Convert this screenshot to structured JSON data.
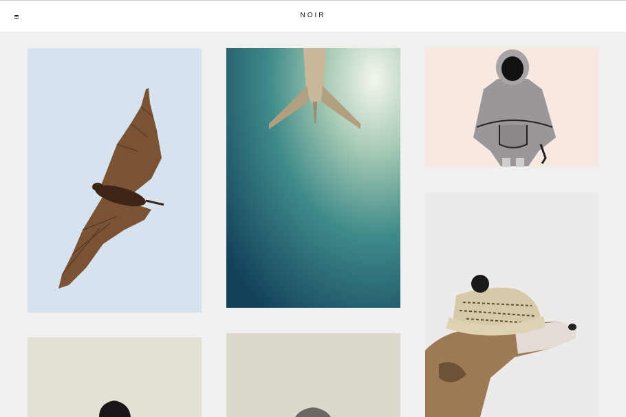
{
  "header": {
    "logo": "NOIR",
    "menu_icon": "hamburger-menu-icon"
  },
  "gallery": {
    "items": [
      {
        "subject": "bat",
        "background": "#d6e3ee"
      },
      {
        "subject": "airplane",
        "background": "#2e7275"
      },
      {
        "subject": "hooded-figure",
        "background": "#f7e8e2"
      },
      {
        "subject": "dog-with-knit-hat",
        "background": "#ecebea"
      },
      {
        "subject": "woman-portrait",
        "background": "#e3e0d6"
      },
      {
        "subject": "figure-portrait",
        "background": "#ddd8cc"
      }
    ]
  },
  "colors": {
    "page_background": "#f0f0ef",
    "header_background": "#ffffff",
    "text": "#111111"
  }
}
